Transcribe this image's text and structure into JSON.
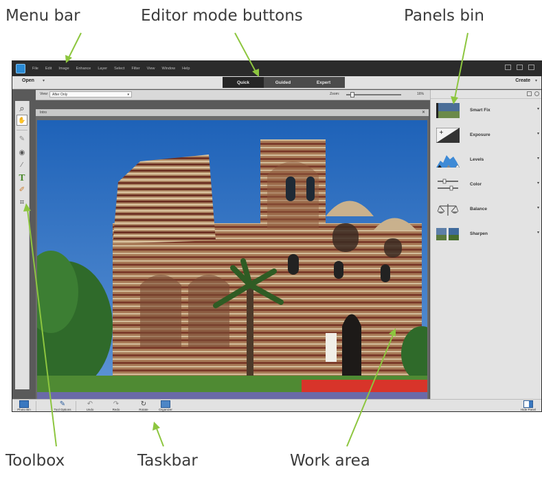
{
  "callouts": {
    "menu_bar": "Menu bar",
    "editor_modes": "Editor mode buttons",
    "panels_bin": "Panels bin",
    "toolbox": "Toolbox",
    "taskbar": "Taskbar",
    "work_area": "Work area"
  },
  "colors": {
    "callout_arrow": "#8dc63f",
    "titlebar": "#2b2b2b",
    "active_mode": "#262626",
    "mode_bar": "#4b4b4b",
    "panel_bg": "#e3e3e3"
  },
  "menu": [
    "File",
    "Edit",
    "Image",
    "Enhance",
    "Layer",
    "Select",
    "Filter",
    "View",
    "Window",
    "Help"
  ],
  "modebar": {
    "open": "Open",
    "modes": [
      "Quick",
      "Guided",
      "Expert"
    ],
    "active_mode": "Quick",
    "create": "Create"
  },
  "options": {
    "view_label": "View:",
    "view_value": "After Only",
    "zoom_label": "Zoom:",
    "zoom_value": "16%"
  },
  "document": {
    "tab": "Intro"
  },
  "toolbox": [
    "zoom-icon",
    "hand-icon",
    "quick-selection-icon",
    "red-eye-icon",
    "whiten-teeth-icon",
    "horizontal-type-icon",
    "spot-healing-icon",
    "crop-icon"
  ],
  "panels": [
    "Smart Fix",
    "Exposure",
    "Levels",
    "Color",
    "Balance",
    "Sharpen"
  ],
  "taskbar": {
    "left": [
      "Photo Bin",
      "Tool Options",
      "Undo",
      "Redo",
      "Rotate",
      "Organizer"
    ],
    "right": "Hide Panel"
  }
}
